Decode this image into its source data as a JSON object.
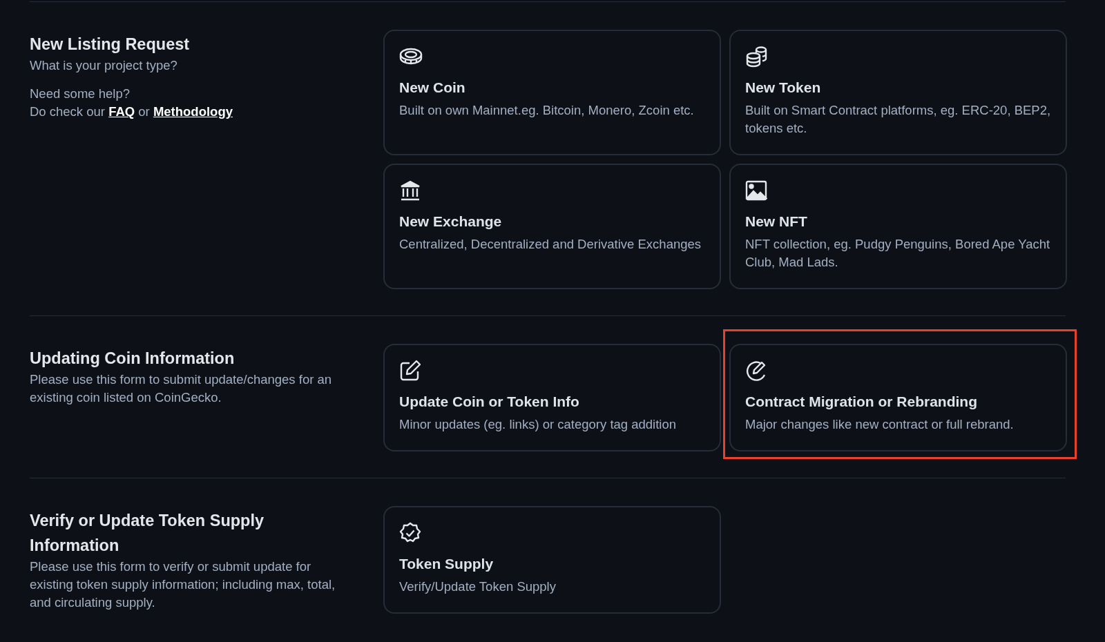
{
  "sections": [
    {
      "title": "New Listing Request",
      "description": "What is your project type?",
      "help": {
        "question": "Need some help?",
        "prefix": "Do check our",
        "links": [
          "FAQ",
          "Methodology"
        ],
        "joiner": "or"
      },
      "cards": [
        {
          "title": "New Coin",
          "description": "Built on own Mainnet.eg. Bitcoin, Monero, Zcoin etc.",
          "highlighted": false
        },
        {
          "title": "New Token",
          "description": "Built on Smart Contract platforms, eg. ERC-20, BEP2, tokens etc.",
          "highlighted": false
        },
        {
          "title": "New Exchange",
          "description": "Centralized, Decentralized and Derivative Exchanges",
          "highlighted": false
        },
        {
          "title": "New NFT",
          "description": "NFT collection, eg. Pudgy Penguins, Bored Ape Yacht Club, Mad Lads.",
          "highlighted": false
        }
      ]
    },
    {
      "title": "Updating Coin Information",
      "description": "Please use this form to submit update/changes for an existing coin listed on CoinGecko.",
      "cards": [
        {
          "title": "Update Coin or Token Info",
          "description": "Minor updates (eg. links) or category tag addition",
          "highlighted": false
        },
        {
          "title": "Contract Migration or Rebranding",
          "description": "Major changes like new contract or full rebrand.",
          "highlighted": true
        }
      ]
    },
    {
      "title": "Verify or Update Token Supply Information",
      "description": "Please use this form to verify or submit update for existing token supply information; including max, total, and circulating supply.",
      "cards": [
        {
          "title": "Token Supply",
          "description": "Verify/Update Token Supply",
          "highlighted": false
        }
      ]
    }
  ]
}
